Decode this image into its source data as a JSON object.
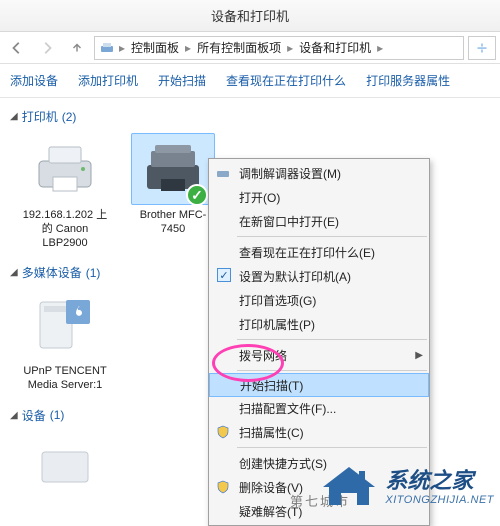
{
  "window": {
    "title": "设备和打印机"
  },
  "breadcrumb": {
    "items": [
      "控制面板",
      "所有控制面板项",
      "设备和打印机"
    ]
  },
  "toolbar": {
    "add_device": "添加设备",
    "add_printer": "添加打印机",
    "start_scan": "开始扫描",
    "see_printing": "查看现在正在打印什么",
    "server_props": "打印服务器属性"
  },
  "groups": {
    "printers": {
      "label": "打印机",
      "count": "(2)"
    },
    "multimedia": {
      "label": "多媒体设备",
      "count": "(1)"
    },
    "devices": {
      "label": "设备",
      "count": "(1)"
    }
  },
  "items": {
    "printer1": {
      "label": "192.168.1.202 上的 Canon LBP2900"
    },
    "printer2": {
      "label": "Brother MFC-7450"
    },
    "media1": {
      "label": "UPnP TENCENT Media Server:1"
    }
  },
  "context_menu": {
    "modem": "调制解调器设置(M)",
    "open": "打开(O)",
    "newwin": "在新窗口中打开(E)",
    "seejobs": "查看现在正在打印什么(E)",
    "default": "设置为默认打印机(A)",
    "prefs": "打印首选项(G)",
    "pprops": "打印机属性(P)",
    "dialnet": "拨号网络",
    "scan": "开始扫描(T)",
    "scancfg": "扫描配置文件(F)...",
    "sprops": "扫描属性(C)",
    "shortcut": "创建快捷方式(S)",
    "delete": "删除设备(V)",
    "trouble": "疑难解答(T)"
  },
  "watermark": {
    "site": "第七城市"
  },
  "brand": {
    "cn": "系统之家",
    "en": "XITONGZHIJIA.NET"
  }
}
